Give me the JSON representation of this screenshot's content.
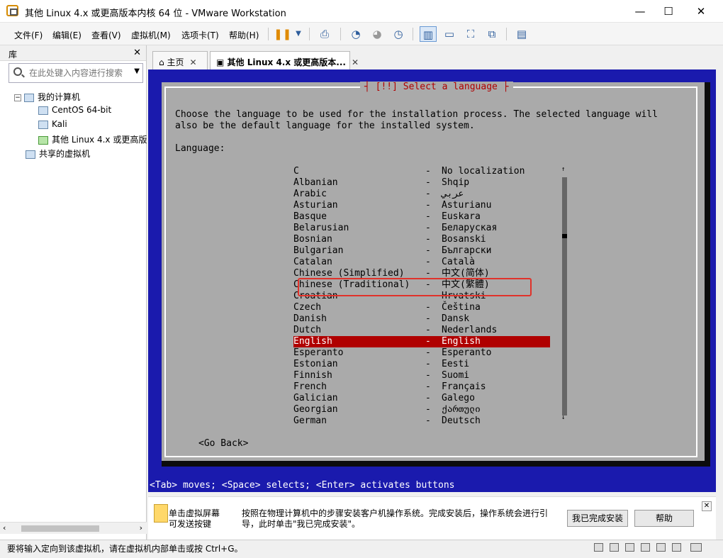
{
  "window": {
    "title": "其他 Linux 4.x 或更高版本内核 64 位 - VMware Workstation",
    "minimize": "—",
    "maximize": "☐",
    "close": "✕"
  },
  "menu": [
    "文件(F)",
    "编辑(E)",
    "查看(V)",
    "虚拟机(M)",
    "选项卡(T)",
    "帮助(H)"
  ],
  "toolbar": {
    "icons": [
      "pause-icon",
      "dropdown-icon",
      "send-keys-icon",
      "snapshot-icon",
      "revert-snapshot-icon",
      "snapshot-manager-icon",
      "console-view-icon",
      "unity-icon",
      "fullscreen-icon",
      "stretch-icon",
      "library-toggle-icon"
    ]
  },
  "library": {
    "title": "库",
    "search_placeholder": "在此处键入内容进行搜索",
    "tree": {
      "root": "我的计算机",
      "vms": [
        "CentOS 64-bit",
        "Kali",
        "其他 Linux 4.x 或更高版"
      ],
      "shared": "共享的虚拟机"
    }
  },
  "tabs": [
    {
      "label": "主页",
      "close": "✕"
    },
    {
      "label": "其他 Linux 4.x 或更高版本...",
      "close": "✕"
    }
  ],
  "installer": {
    "title": "[!!] Select a language",
    "intro_line1": "Choose the language to be used for the installation process. The selected language will",
    "intro_line2": "also be the default language for the installed system.",
    "language_label": "Language:",
    "separator": "-",
    "languages": [
      {
        "name": "C",
        "native": "No localization"
      },
      {
        "name": "Albanian",
        "native": "Shqip"
      },
      {
        "name": "Arabic",
        "native": "عربي"
      },
      {
        "name": "Asturian",
        "native": "Asturianu"
      },
      {
        "name": "Basque",
        "native": "Euskara"
      },
      {
        "name": "Belarusian",
        "native": "Беларуская"
      },
      {
        "name": "Bosnian",
        "native": "Bosanski"
      },
      {
        "name": "Bulgarian",
        "native": "Български"
      },
      {
        "name": "Catalan",
        "native": "Català"
      },
      {
        "name": "Chinese (Simplified)",
        "native": "中文(简体)"
      },
      {
        "name": "Chinese (Traditional)",
        "native": "中文(繁體)"
      },
      {
        "name": "Croatian",
        "native": "Hrvatski"
      },
      {
        "name": "Czech",
        "native": "Čeština"
      },
      {
        "name": "Danish",
        "native": "Dansk"
      },
      {
        "name": "Dutch",
        "native": "Nederlands"
      },
      {
        "name": "English",
        "native": "English"
      },
      {
        "name": "Esperanto",
        "native": "Esperanto"
      },
      {
        "name": "Estonian",
        "native": "Eesti"
      },
      {
        "name": "Finnish",
        "native": "Suomi"
      },
      {
        "name": "French",
        "native": "Français"
      },
      {
        "name": "Galician",
        "native": "Galego"
      },
      {
        "name": "Georgian",
        "native": "ქართული"
      },
      {
        "name": "German",
        "native": "Deutsch"
      }
    ],
    "selected_language": "English",
    "highlighted_language": "Chinese (Simplified)",
    "scroll_up": "↑",
    "scroll_down": "↓",
    "go_back": "<Go Back>",
    "help_line": "<Tab> moves; <Space> selects; <Enter> activates buttons"
  },
  "hint_bar": {
    "left_text": "单击虚拟屏幕可发送按键",
    "message": "按照在物理计算机中的步骤安装客户机操作系统。完成安装后，操作系统会进行引导，此时单击\"我已完成安装\"。",
    "done_button": "我已完成安装",
    "help_button": "帮助",
    "close": "✕"
  },
  "status_bar": {
    "message": "要将输入定向到该虚拟机，请在虚拟机内部单击或按 Ctrl+G。"
  },
  "colors": {
    "console_blue": "#1a1aad",
    "dialog_gray": "#aaaaaa",
    "selection_red": "#b00000",
    "annotation_red": "#e0322a"
  }
}
